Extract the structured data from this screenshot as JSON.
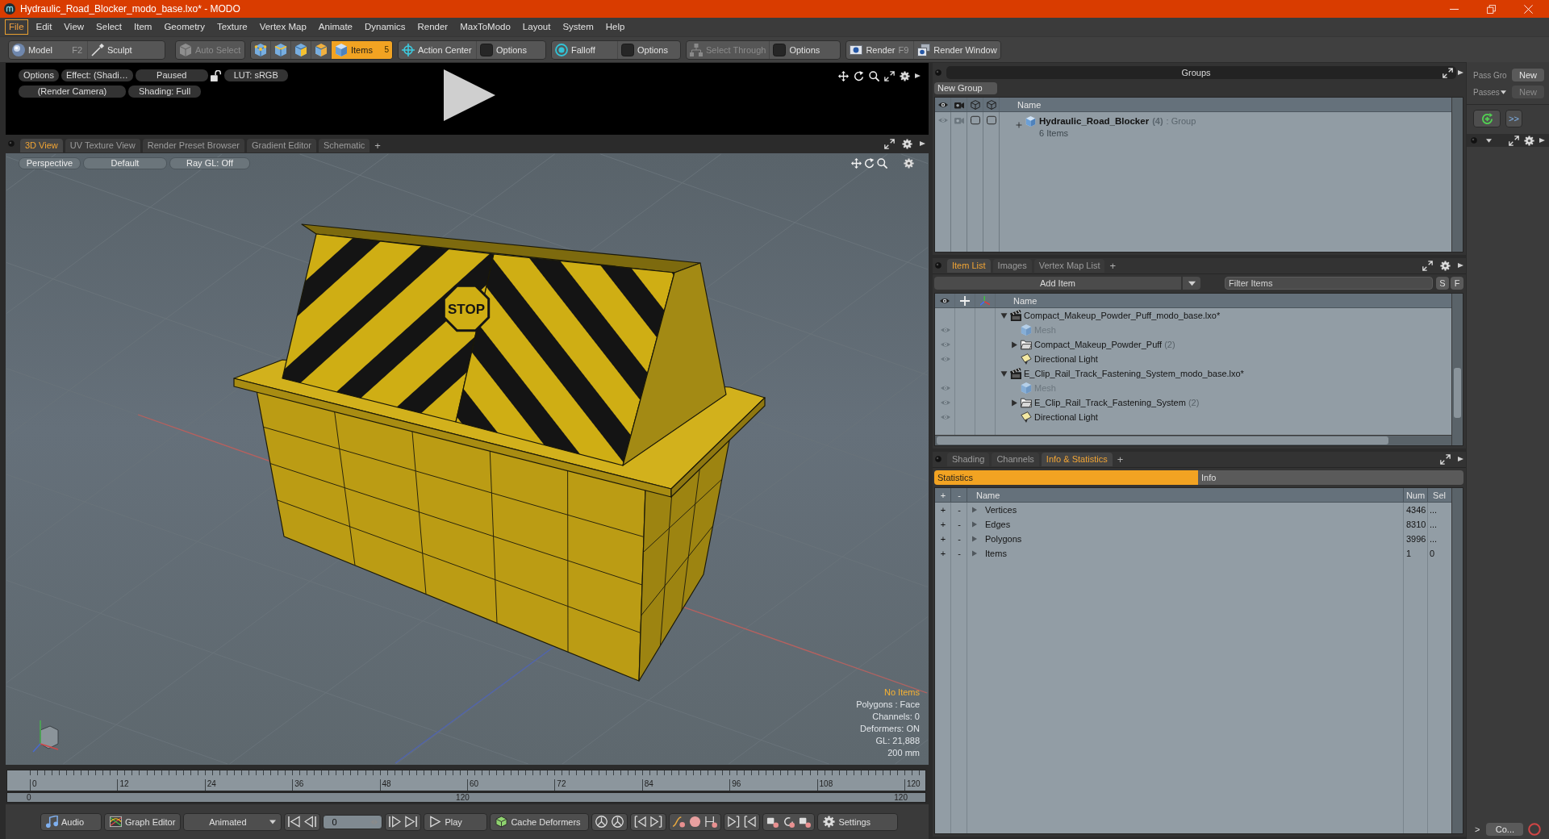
{
  "window": {
    "title": "Hydraulic_Road_Blocker_modo_base.lxo* - MODO"
  },
  "menu": [
    {
      "label": "File",
      "selected": true
    },
    {
      "label": "Edit",
      "selected": false
    },
    {
      "label": "View",
      "selected": false
    },
    {
      "label": "Select",
      "selected": false
    },
    {
      "label": "Item",
      "selected": false
    },
    {
      "label": "Geometry",
      "selected": false
    },
    {
      "label": "Texture",
      "selected": false
    },
    {
      "label": "Vertex Map",
      "selected": false
    },
    {
      "label": "Animate",
      "selected": false
    },
    {
      "label": "Dynamics",
      "selected": false
    },
    {
      "label": "Render",
      "selected": false
    },
    {
      "label": "MaxToModo",
      "selected": false
    },
    {
      "label": "Layout",
      "selected": false
    },
    {
      "label": "System",
      "selected": false
    },
    {
      "label": "Help",
      "selected": false
    }
  ],
  "toolbar": [
    [
      {
        "label": "Model",
        "shortcut": "F2",
        "disabled": false
      },
      {
        "label": "Sculpt",
        "disabled": false
      }
    ],
    [
      {
        "label": "Auto Select",
        "disabled": true
      }
    ],
    [
      {
        "selected": false
      },
      {
        "selected": false
      },
      {
        "selected": false
      },
      {
        "selected": false
      },
      {
        "label": "Items",
        "count": "5",
        "selected": true
      }
    ],
    [
      {
        "label": "Action Center",
        "disabled": false
      },
      {
        "label": "Options",
        "disabled": false
      }
    ],
    [
      {
        "label": "Falloff",
        "disabled": false
      },
      {
        "label": "Options",
        "disabled": false
      }
    ],
    [
      {
        "label": "Select Through",
        "disabled": true
      },
      {
        "label": "Options",
        "disabled": false
      }
    ],
    [
      {
        "label": "Render",
        "shortcut": "F9",
        "disabled": false
      },
      {
        "label": "Render Window",
        "disabled": false
      }
    ]
  ],
  "render_preview": {
    "options": "Options",
    "effect": "Effect: (Shadi…",
    "state": "Paused",
    "lut": "LUT: sRGB",
    "camera": "(Render Camera)",
    "shading": "Shading: Full"
  },
  "viewport": {
    "tabs": [
      {
        "label": "3D View",
        "selected": true
      },
      {
        "label": "UV Texture View",
        "selected": false
      },
      {
        "label": "Render Preset Browser",
        "selected": false
      },
      {
        "label": "Gradient Editor",
        "selected": false
      },
      {
        "label": "Schematic",
        "selected": false
      }
    ],
    "add_tab": "+",
    "view_options": [
      "Perspective",
      "Default",
      "Ray GL: Off"
    ],
    "model_label": "STOP",
    "info": [
      {
        "text": "No Items",
        "highlighted": true
      },
      {
        "text": "Polygons : Face",
        "highlighted": false
      },
      {
        "text": "Channels: 0",
        "highlighted": false
      },
      {
        "text": "Deformers: ON",
        "highlighted": false
      },
      {
        "text": "GL: 21,888",
        "highlighted": false
      },
      {
        "text": "200 mm",
        "highlighted": false
      }
    ]
  },
  "timeline": {
    "ticks": [
      "0",
      "12",
      "24",
      "36",
      "48",
      "60",
      "72",
      "84",
      "96",
      "108",
      "120"
    ],
    "range_labels": [
      "0",
      "120",
      "120"
    ]
  },
  "bottom_bar": {
    "audio": "Audio",
    "graph_editor": "Graph Editor",
    "mode": "Animated",
    "frame": "0",
    "play": "Play",
    "cache": "Cache Deformers",
    "settings": "Settings"
  },
  "groups_panel": {
    "title": "Groups",
    "new_group": "New Group",
    "name_column": "Name",
    "rows": [
      {
        "name": "Hydraulic_Road_Blocker",
        "count": "(4)",
        "type": ": Group",
        "summary": "6 Items",
        "expanded": false
      }
    ]
  },
  "item_list": {
    "tabs": [
      {
        "label": "Item List",
        "selected": true
      },
      {
        "label": "Images",
        "selected": false
      },
      {
        "label": "Vertex Map List",
        "selected": false
      }
    ],
    "add_tab": "+",
    "add_item": "Add Item",
    "filter": {
      "placeholder": "Filter Items"
    },
    "filter_buttons": [
      "S",
      "F"
    ],
    "name_column": "Name",
    "items": [
      {
        "kind": "scene",
        "label": "Compact_Makeup_Powder_Puff_modo_base.lxo*",
        "expanded": true,
        "visible": false,
        "disabled": false,
        "children": [
          {
            "kind": "mesh",
            "label": "Mesh",
            "visible": true,
            "disabled": true
          },
          {
            "kind": "group",
            "label": "Compact_Makeup_Powder_Puff",
            "count": "(2)",
            "expanded": false,
            "visible": true,
            "disabled": false
          },
          {
            "kind": "light",
            "label": "Directional Light",
            "visible": true,
            "disabled": false
          }
        ]
      },
      {
        "kind": "scene",
        "label": "E_Clip_Rail_Track_Fastening_System_modo_base.lxo*",
        "expanded": true,
        "visible": false,
        "disabled": false,
        "children": [
          {
            "kind": "mesh",
            "label": "Mesh",
            "visible": true,
            "disabled": true
          },
          {
            "kind": "group",
            "label": "E_Clip_Rail_Track_Fastening_System",
            "count": "(2)",
            "expanded": false,
            "visible": true,
            "disabled": false
          },
          {
            "kind": "light",
            "label": "Directional Light",
            "visible": true,
            "disabled": false
          }
        ]
      }
    ]
  },
  "statistics": {
    "tabs": [
      {
        "label": "Shading",
        "selected": false
      },
      {
        "label": "Channels",
        "selected": false
      },
      {
        "label": "Info & Statistics",
        "selected": true
      }
    ],
    "add_tab": "+",
    "subtabs": [
      {
        "label": "Statistics",
        "selected": true
      },
      {
        "label": "Info",
        "selected": false
      }
    ],
    "columns": [
      "+",
      "-",
      "Name",
      "Num",
      "Sel"
    ],
    "rows": [
      {
        "add": "+",
        "remove": "-",
        "name": "Vertices",
        "num": "4346",
        "sel": "...",
        "expanded": false
      },
      {
        "add": "+",
        "remove": "-",
        "name": "Edges",
        "num": "8310",
        "sel": "...",
        "expanded": false
      },
      {
        "add": "+",
        "remove": "-",
        "name": "Polygons",
        "num": "3996",
        "sel": "...",
        "expanded": false
      },
      {
        "add": "+",
        "remove": "-",
        "name": "Items",
        "num": "1",
        "sel": "0",
        "expanded": false
      }
    ]
  },
  "pass_panel": {
    "pass_groups_label": "Pass Gro",
    "pass_groups_new": {
      "label": "New",
      "disabled": false
    },
    "passes_label": "Passes",
    "passes_new": {
      "label": "New",
      "disabled": true
    },
    "more": ">>",
    "expand": ">",
    "collapsed_panel": "Co..."
  }
}
